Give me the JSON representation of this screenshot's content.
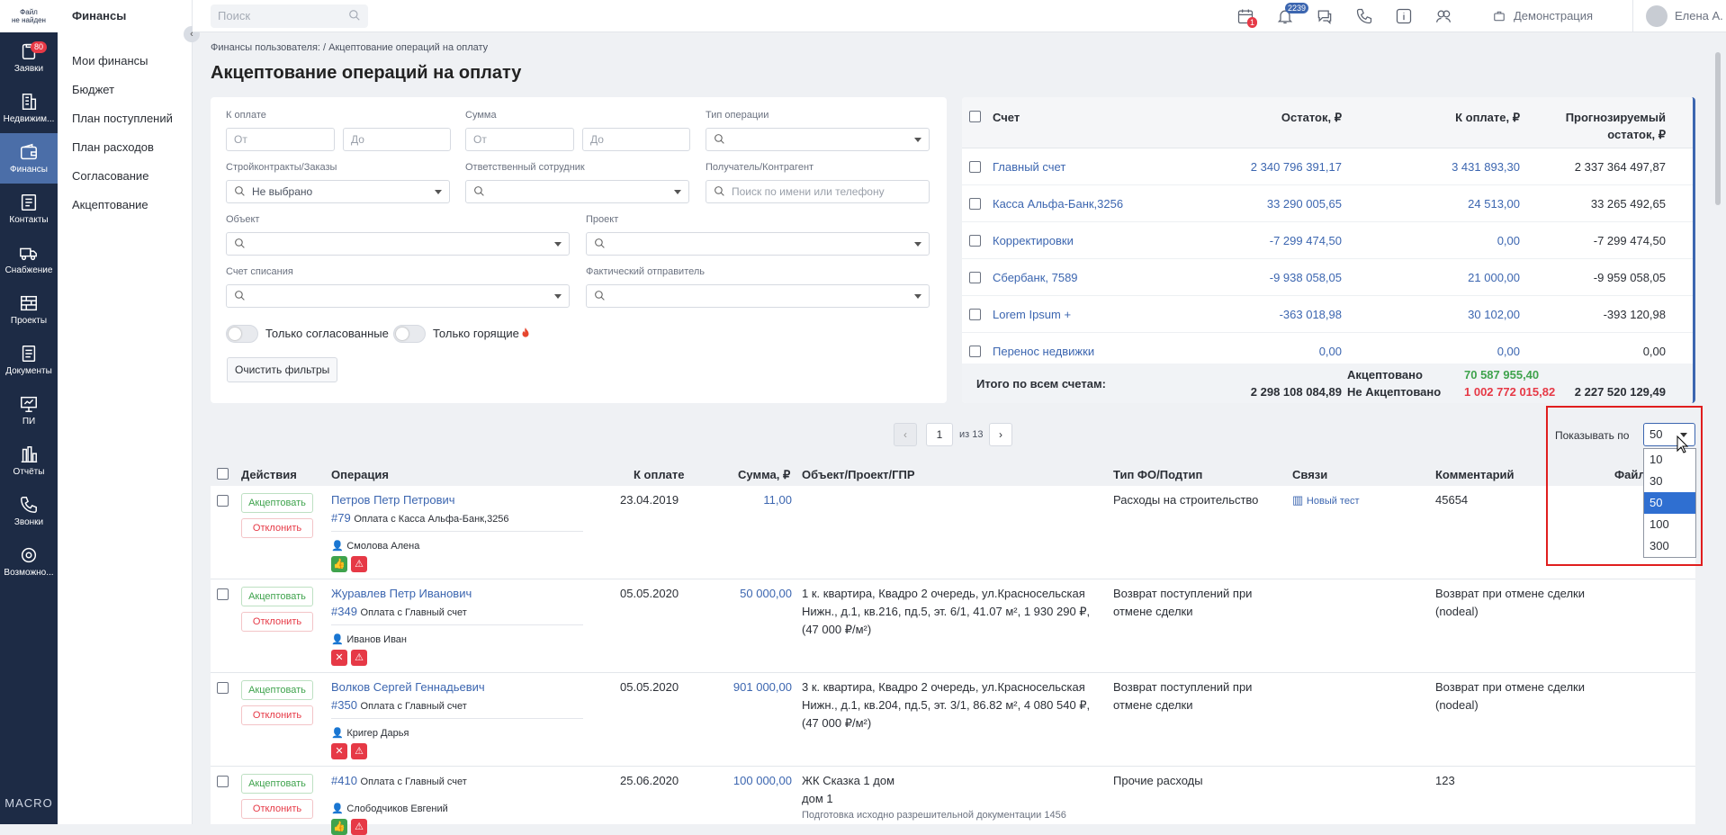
{
  "rail": {
    "logo": "Файл\nне найден",
    "items": [
      {
        "label": "Заявки",
        "badge": "80",
        "icon": "clipboard-icon"
      },
      {
        "label": "Недвижим...",
        "icon": "building-icon"
      },
      {
        "label": "Финансы",
        "icon": "wallet-icon",
        "active": true
      },
      {
        "label": "Контакты",
        "icon": "contacts-icon"
      },
      {
        "label": "Снабжение",
        "icon": "truck-icon"
      },
      {
        "label": "Проекты",
        "icon": "bricks-icon"
      },
      {
        "label": "Документы",
        "icon": "document-icon"
      },
      {
        "label": "ПИ",
        "icon": "presentation-icon"
      },
      {
        "label": "Отчёты",
        "icon": "bar-chart-icon"
      },
      {
        "label": "Звонки",
        "icon": "phone-icon"
      },
      {
        "label": "Возможно...",
        "icon": "gear-icon"
      }
    ],
    "brand": "MACRO"
  },
  "subnav": {
    "title": "Финансы",
    "items": [
      "Мои финансы",
      "Бюджет",
      "План поступлений",
      "План расходов",
      "Согласование",
      "Акцептование"
    ]
  },
  "topbar": {
    "search_placeholder": "Поиск",
    "calendar_badge": "1",
    "notify_badge": "2239",
    "demo": "Демонстрация",
    "user": "Елена А."
  },
  "breadcrumb": {
    "parent": "Финансы пользователя:",
    "sep": "/",
    "current": "Акцептование операций на оплату"
  },
  "page_title": "Акцептование операций на оплату",
  "filters": {
    "k_oplate": "К оплате",
    "summa": "Сумма",
    "tip": "Тип операции",
    "from": "От",
    "to": "До",
    "stroy": "Стройконтракты/Заказы",
    "stroy_value": "Не выбрано",
    "otv": "Ответственный сотрудник",
    "poluch": "Получатель/Контрагент",
    "poluch_placeholder": "Поиск по имени или телефону",
    "obekt": "Объект",
    "proekt": "Проект",
    "schet": "Счет списания",
    "otprav": "Фактический отправитель",
    "only_agreed": "Только согласованные",
    "only_urgent": "Только горящие",
    "clear": "Очистить фильтры"
  },
  "accounts": {
    "head": {
      "schet": "Счет",
      "ostatok": "Остаток, ₽",
      "k_oplate": "К оплате, ₽",
      "prognoz1": "Прогнозируемый",
      "prognoz2": "остаток, ₽"
    },
    "rows": [
      {
        "name": "Главный счет",
        "ost": "2 340 796 391,17",
        "pay": "3 431 893,30",
        "prog": "2 337 364 497,87"
      },
      {
        "name": "Касса Альфа-Банк,3256",
        "ost": "33 290 005,65",
        "pay": "24 513,00",
        "prog": "33 265 492,65"
      },
      {
        "name": "Корректировки",
        "ost": "-7 299 474,50",
        "pay": "0,00",
        "prog": "-7 299 474,50"
      },
      {
        "name": "Сбербанк, 7589",
        "ost": "-9 938 058,05",
        "pay": "21 000,00",
        "prog": "-9 959 058,05"
      },
      {
        "name": "Lorem Ipsum +",
        "ost": "-363 018,98",
        "pay": "30 102,00",
        "prog": "-393 120,98"
      },
      {
        "name": "Перенос недвижки",
        "ost": "0,00",
        "pay": "0,00",
        "prog": "0,00"
      }
    ],
    "foot": {
      "label": "Итого по всем счетам:",
      "ost": "2 298 108 084,89",
      "accepted_label": "Акцептовано",
      "accepted": "70 587 955,40",
      "not_label": "Не Акцептовано",
      "not": "1 002 772 015,82",
      "prog": "2 227 520 129,49"
    }
  },
  "pagination": {
    "page": "1",
    "of": "из 13"
  },
  "per_page": {
    "label": "Показывать по",
    "value": "50",
    "options": [
      "10",
      "30",
      "50",
      "100",
      "300"
    ]
  },
  "ops_head": {
    "actions": "Действия",
    "operation": "Операция",
    "k_oplate": "К оплате",
    "summa": "Сумма, ₽",
    "object": "Объект/Проект/ГПР",
    "type": "Тип ФО/Подтип",
    "links": "Связи",
    "comment": "Комментарий",
    "files": "Файл"
  },
  "ops": [
    {
      "accept": "Акцептовать",
      "reject": "Отклонить",
      "name": "Петров Петр Петрович",
      "num": "#79",
      "desc": "Оплата с Касса Альфа-Банк,3256",
      "person": "Смолова Алена",
      "date": "23.04.2019",
      "sum": "11,00",
      "object": "",
      "type": "Расходы на строительство",
      "link": "Новый тест",
      "comment": "45654"
    },
    {
      "accept": "Акцептовать",
      "reject": "Отклонить",
      "name": "Журавлев Петр Иванович",
      "num": "#349",
      "desc": "Оплата с Главный счет",
      "person": "Иванов Иван",
      "date": "05.05.2020",
      "sum": "50 000,00",
      "object": "1 к. квартира, Квадро 2 очередь, ул.Красносельская Нижн., д.1, кв.216, пд.5, эт. 6/1, 41.07 м², 1 930 290 ₽, (47 000 ₽/м²)",
      "type": "Возврат поступлений при отмене сделки",
      "link": "",
      "comment": "Возврат при отмене сделки (nodeal)"
    },
    {
      "accept": "Акцептовать",
      "reject": "Отклонить",
      "name": "Волков Сергей Геннадьевич",
      "num": "#350",
      "desc": "Оплата с Главный счет",
      "person": "Кригер Дарья",
      "date": "05.05.2020",
      "sum": "901 000,00",
      "object": "3 к. квартира, Квадро 2 очередь, ул.Красносельская Нижн., д.1, кв.204, пд.5, эт. 3/1, 86.82 м², 4 080 540 ₽, (47 000 ₽/м²)",
      "type": "Возврат поступлений при отмене сделки",
      "link": "",
      "comment": "Возврат при отмене сделки (nodeal)"
    },
    {
      "accept": "Акцептовать",
      "reject": "Отклонить",
      "name": "",
      "num": "#410",
      "desc": "Оплата с Главный счет",
      "person": "Слободчиков Евгений",
      "date": "25.06.2020",
      "sum": "100 000,00",
      "object": "ЖК Сказка 1 дом",
      "object2": "дом 1",
      "object3": "Подготовка исходно разрешительной документации 1456",
      "type": "Прочие расходы",
      "link": "",
      "comment": "123"
    }
  ]
}
